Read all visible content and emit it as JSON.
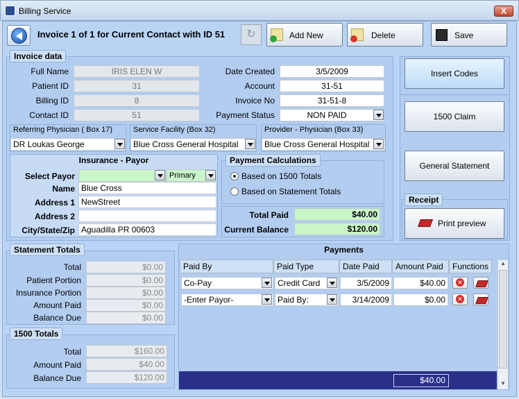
{
  "window": {
    "title": "Billing Service",
    "close": "X"
  },
  "toolbar": {
    "title": "Invoice 1 of 1 for Current Contact with ID 51",
    "refresh": "↻",
    "add_new": "Add New",
    "delete": "Delete",
    "save": "Save"
  },
  "invoice": {
    "legend": "Invoice data",
    "full_name_label": "Full Name",
    "full_name": "IRIS ELEN W",
    "patient_id_label": "Patient ID",
    "patient_id": "31",
    "billing_id_label": "Billing ID",
    "billing_id": "8",
    "contact_id_label": "Contact ID",
    "contact_id": "51",
    "date_created_label": "Date Created",
    "date_created": "3/5/2009",
    "account_label": "Account",
    "account": "31-51",
    "invoice_no_label": "Invoice No",
    "invoice_no": "31-51-8",
    "payment_status_label": "Payment Status",
    "payment_status": "NON PAID",
    "referring_label": "Referring Physician ( Box 17)",
    "referring": "DR Loukas George",
    "facility_label": "Service Facility (Box 32)",
    "facility": "Blue Cross General Hospital",
    "provider_label": "Provider - Physician (Box 33)",
    "provider": "Blue Cross General Hospital"
  },
  "insurance": {
    "legend": "Insurance - Payor",
    "select_payor_label": "Select Payor",
    "select_payor": "",
    "priority": "Primary",
    "name_label": "Name",
    "name": "Blue Cross",
    "addr1_label": "Address 1",
    "addr1": "NewStreet",
    "addr2_label": "Address 2",
    "addr2": "",
    "city_label": "City/State/Zip",
    "city": "Aguadilla PR 00603"
  },
  "payment_calc": {
    "legend": "Payment Calculations",
    "opt1": "Based on 1500 Totals",
    "opt2": "Based on Statement Totals",
    "total_paid_label": "Total Paid",
    "total_paid": "$40.00",
    "balance_label": "Current Balance",
    "balance": "$120.00"
  },
  "side": {
    "insert_codes": "Insert Codes",
    "claim": "1500 Claim",
    "general_statement": "General Statement",
    "receipt_legend": "Receipt",
    "print_preview": "Print preview"
  },
  "statement": {
    "legend": "Statement Totals",
    "rows": [
      {
        "label": "Total",
        "value": "$0.00"
      },
      {
        "label": "Patient Portion",
        "value": "$0.00"
      },
      {
        "label": "Insurance Portion",
        "value": "$0.00"
      },
      {
        "label": "Amount Paid",
        "value": "$0.00"
      },
      {
        "label": "Balance Due",
        "value": "$0.00"
      }
    ]
  },
  "totals1500": {
    "legend": "1500  Totals",
    "rows": [
      {
        "label": "Total",
        "value": "$160.00"
      },
      {
        "label": "Amount Paid",
        "value": "$40.00"
      },
      {
        "label": "Balance Due",
        "value": "$120.00"
      }
    ]
  },
  "payments": {
    "title": "Payments",
    "headers": [
      "Paid By",
      "Paid Type",
      "Date Paid",
      "Amount Paid",
      "Functions"
    ],
    "rows": [
      {
        "paid_by": "Co-Pay",
        "paid_type": "Credit Card",
        "date": "3/5/2009",
        "amount": "$40.00"
      },
      {
        "paid_by": "-Enter Payor-",
        "paid_type": "Paid By:",
        "date": "3/14/2009",
        "amount": "$0.00"
      }
    ],
    "footer_total": "$40.00"
  },
  "colors": {
    "accent": "#b9d3f4",
    "green_field": "#c9f5c9",
    "footer": "#2a2f8a"
  }
}
